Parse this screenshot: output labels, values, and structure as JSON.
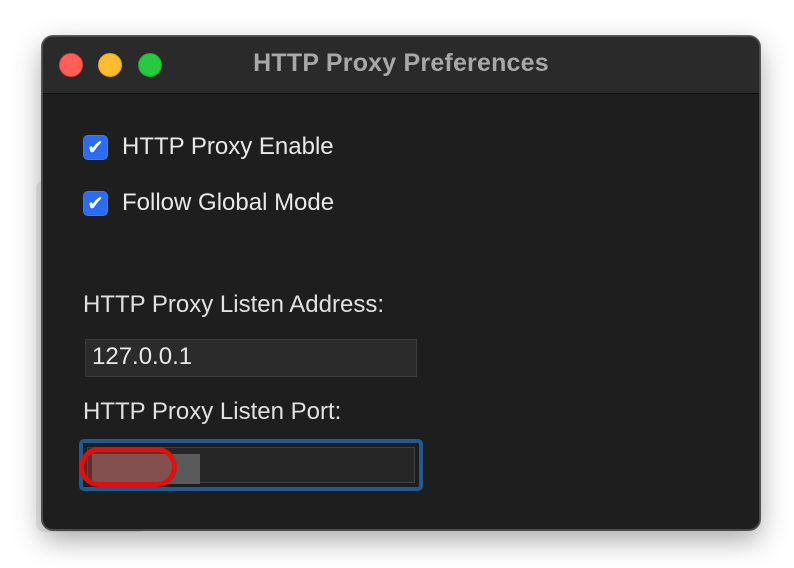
{
  "window": {
    "title": "HTTP Proxy Preferences"
  },
  "checkboxes": [
    {
      "label": "HTTP Proxy Enable",
      "checked": true
    },
    {
      "label": "Follow Global Mode",
      "checked": true
    }
  ],
  "listen_address": {
    "label": "HTTP Proxy Listen Address:",
    "value": "127.0.0.1"
  },
  "listen_port": {
    "label": "HTTP Proxy Listen Port:",
    "value_redacted": true,
    "focused": true
  },
  "icons": {
    "check": "✔",
    "close": "close-circle",
    "minimize": "minimize-circle",
    "zoom": "zoom-circle"
  },
  "colors": {
    "window_bg": "#1e1e1e",
    "titlebar_bg": "#2a2a2a",
    "checkbox_blue": "#2a6df4",
    "focus_ring": "#1f5a94",
    "annotation_red": "#e01010"
  }
}
